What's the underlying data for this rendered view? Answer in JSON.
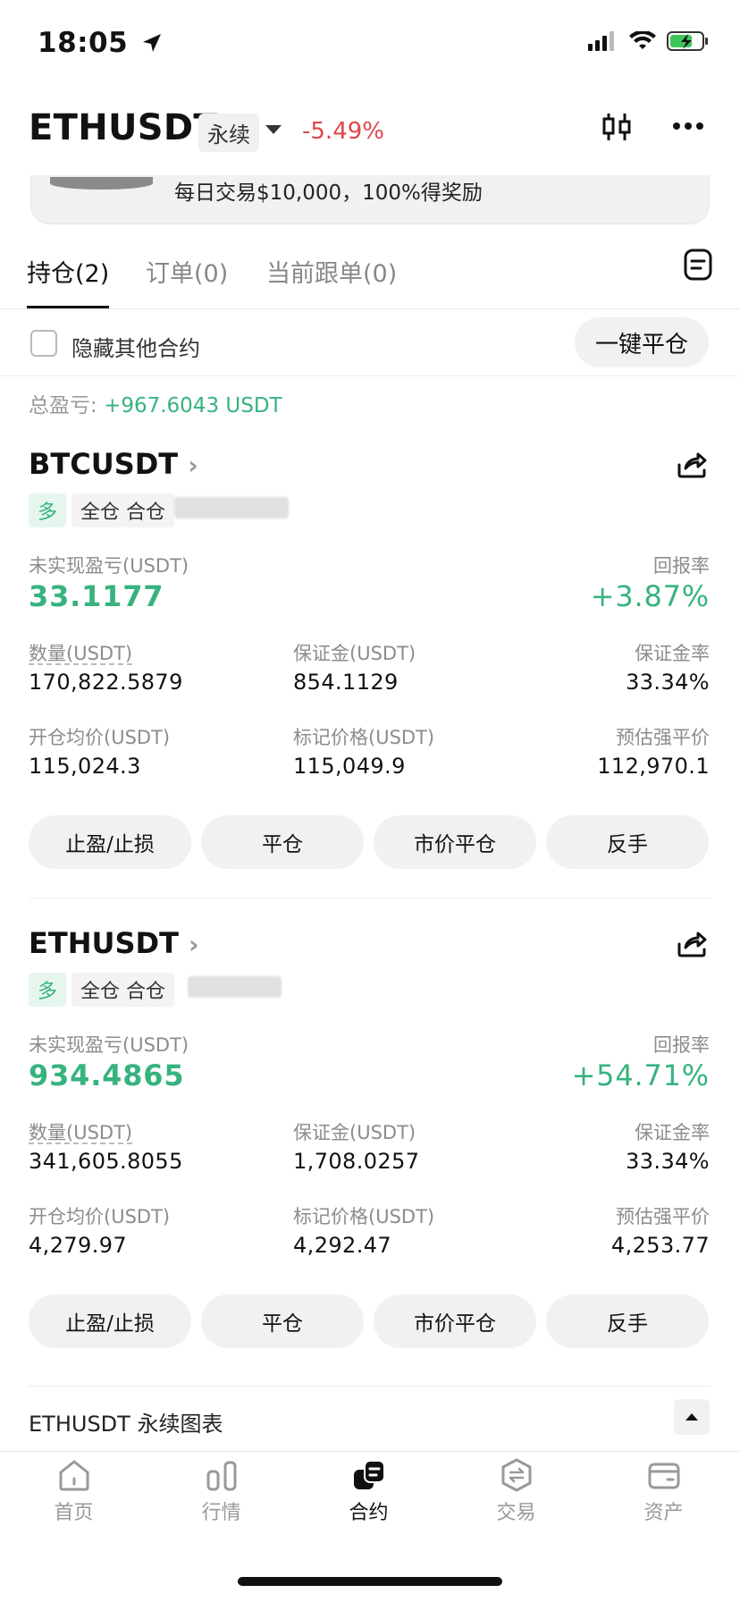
{
  "status_bar": {
    "time": "18:05"
  },
  "header": {
    "symbol": "ETHUSDT",
    "contract_type": "永续",
    "change": "-5.49%",
    "icons": [
      "candlestick-icon",
      "more-icon"
    ]
  },
  "banner": {
    "text": "每日交易$10,000，100%得奖励"
  },
  "tabs": [
    {
      "label": "持仓(2)",
      "active": true
    },
    {
      "label": "订单(0)",
      "active": false
    },
    {
      "label": "当前跟单(0)",
      "active": false
    }
  ],
  "filter": {
    "hide_label": "隐藏其他合约",
    "close_all": "一键平仓"
  },
  "total_pnl": {
    "label": "总盈亏:",
    "value": "+967.6043 USDT"
  },
  "positions": [
    {
      "symbol": "BTCUSDT",
      "side": "多",
      "mode": "全仓 合仓",
      "unrealized_label": "未实现盈亏(USDT)",
      "unrealized": "33.1177",
      "roe_label": "回报率",
      "roe": "+3.87%",
      "qty_label": "数量(USDT)",
      "qty": "170,822.5879",
      "margin_label": "保证金(USDT)",
      "margin": "854.1129",
      "margin_ratio_label": "保证金率",
      "margin_ratio": "33.34%",
      "entry_label": "开仓均价(USDT)",
      "entry": "115,024.3",
      "mark_label": "标记价格(USDT)",
      "mark": "115,049.9",
      "liq_label": "预估强平价",
      "liq": "112,970.1",
      "buttons": [
        "止盈/止损",
        "平仓",
        "市价平仓",
        "反手"
      ]
    },
    {
      "symbol": "ETHUSDT",
      "side": "多",
      "mode": "全仓 合仓",
      "unrealized_label": "未实现盈亏(USDT)",
      "unrealized": "934.4865",
      "roe_label": "回报率",
      "roe": "+54.71%",
      "qty_label": "数量(USDT)",
      "qty": "341,605.8055",
      "margin_label": "保证金(USDT)",
      "margin": "1,708.0257",
      "margin_ratio_label": "保证金率",
      "margin_ratio": "33.34%",
      "entry_label": "开仓均价(USDT)",
      "entry": "4,279.97",
      "mark_label": "标记价格(USDT)",
      "mark": "4,292.47",
      "liq_label": "预估强平价",
      "liq": "4,253.77",
      "buttons": [
        "止盈/止损",
        "平仓",
        "市价平仓",
        "反手"
      ]
    }
  ],
  "chart_bar": {
    "label": "ETHUSDT 永续图表"
  },
  "bottom_nav": [
    {
      "label": "首页",
      "icon": "home-icon",
      "active": false
    },
    {
      "label": "行情",
      "icon": "market-icon",
      "active": false
    },
    {
      "label": "合约",
      "icon": "futures-icon",
      "active": true
    },
    {
      "label": "交易",
      "icon": "trade-icon",
      "active": false
    },
    {
      "label": "资产",
      "icon": "wallet-icon",
      "active": false
    }
  ],
  "colors": {
    "up": "#37b37e",
    "down": "#e0464c"
  }
}
